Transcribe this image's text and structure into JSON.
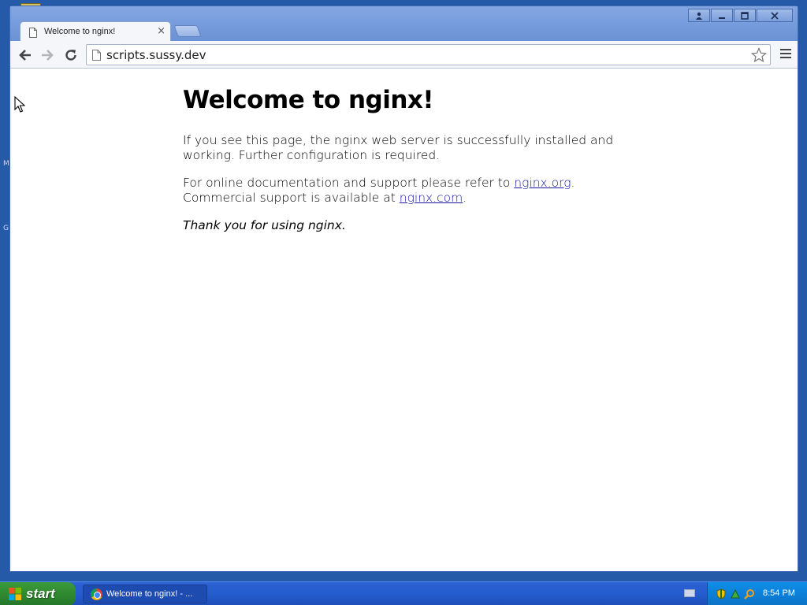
{
  "browser": {
    "tab_title": "Welcome to nginx!",
    "tab_close": "×",
    "url": "scripts.sussy.dev"
  },
  "page": {
    "heading": "Welcome to nginx!",
    "para1": "If you see this page, the nginx web server is successfully installed and working. Further configuration is required.",
    "para2_prefix": "For online documentation and support please refer to ",
    "link1": "nginx.org",
    "para2_mid": ".",
    "para2_line2": "Commercial support is available at ",
    "link2": "nginx.com",
    "para2_end": ".",
    "thanks": "Thank you for using nginx."
  },
  "taskbar": {
    "start_label": "start",
    "task_label": "Welcome to nginx! - ...",
    "clock": "8:54 PM"
  },
  "desktop": {
    "letters": [
      "M",
      "G"
    ]
  },
  "colors": {
    "link": "#1a1aa8",
    "taskbar": "#245dcf",
    "start": "#2f8a2f"
  }
}
